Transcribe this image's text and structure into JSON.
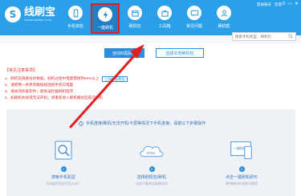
{
  "app": {
    "logo_mark": "S",
    "title": "线刷宝",
    "subtitle": "xianshuabao.com"
  },
  "top_links": [
    "登录账号",
    "反馈"
  ],
  "window_controls": [
    "≡",
    "—",
    "✕"
  ],
  "tabs": [
    {
      "label": "手机体检",
      "icon": "phone-icon",
      "active": false
    },
    {
      "label": "一键刷机",
      "icon": "flash-icon",
      "active": true
    },
    {
      "label": "刷机包",
      "icon": "package-icon",
      "active": false
    },
    {
      "label": "工具箱",
      "icon": "toolbox-icon",
      "active": false
    },
    {
      "label": "常见问题",
      "icon": "faq-icon",
      "active": false
    },
    {
      "label": "刷机帮",
      "icon": "user-icon",
      "active": false
    }
  ],
  "search": {
    "placeholder": "搜索手机机型、刷机包"
  },
  "buttons": {
    "primary": "自动匹配刷机",
    "secondary": "选择本地刷机包"
  },
  "notes": {
    "title": "【常见注意事项】",
    "items": [
      "1、刷机前请备份好数据，刷机过程中电量需保持50%以上",
      "2、请使用一条原装数据线连接手机与电脑",
      "3、请关闭杀毒软件，避免误拦截刷机程序",
      "4、如刷机失败或无法开机，请重新进入刷机模式后再次刷机"
    ],
    "link": "立即查看教程"
  },
  "panel": {
    "heading": "手机连接/刷机/无法开机/卡屏等情况下手机连接，请按以下步骤操作",
    "steps": [
      {
        "num": "1",
        "title": "搜索手机机型",
        "sub": "不知道手机型号怎么办？"
      },
      {
        "num": "2",
        "title": "选择刷机包/刷机",
        "sub": "自动下载并匹配刷机包"
      },
      {
        "num": "3",
        "title": "点击一键刷机即可",
        "sub": "等待刷机完成即可使用"
      }
    ],
    "screen_label": "一键刷机",
    "rom_label": "ROM"
  },
  "colors": {
    "header": "#2aa0e8",
    "accent": "#2a8fe0",
    "warning": "#e03030",
    "highlight": "#e02020"
  }
}
